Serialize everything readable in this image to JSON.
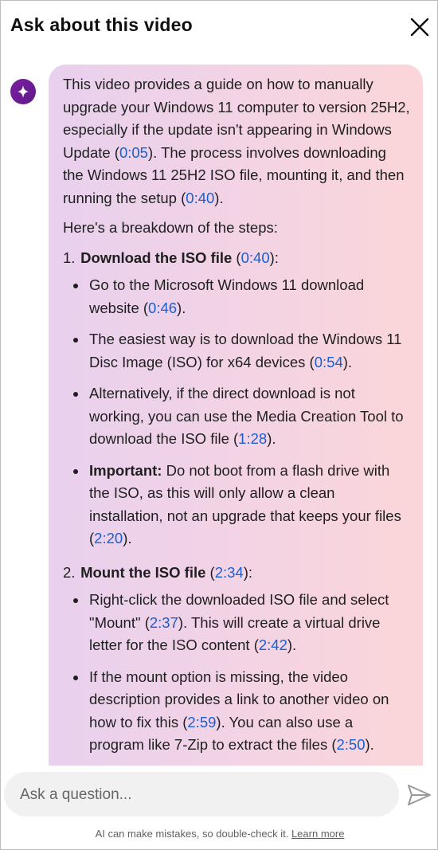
{
  "header": {
    "title": "Ask about this video"
  },
  "message": {
    "intro": {
      "t1": "This video provides a guide on how to manually upgrade your Windows 11 computer to version 25H2, especially if the update isn't appearing in Windows Update (",
      "ts1": "0:05",
      "t2": "). The process involves downloading the Windows 11 25H2 ISO file, mounting it, and then running the setup (",
      "ts2": "0:40",
      "t3": ")."
    },
    "breakdown": "Here's a breakdown of the steps:",
    "steps": [
      {
        "num": "1.",
        "title": "Download the ISO file",
        "ts": "0:40",
        "bullets": [
          {
            "text": "Go to the Microsoft Windows 11 download website (",
            "ts": "0:46",
            "end": ")."
          },
          {
            "text": "The easiest way is to download the Windows 11 Disc Image (ISO) for x64 devices (",
            "ts": "0:54",
            "end": ")."
          },
          {
            "text": "Alternatively, if the direct download is not working, you can use the Media Creation Tool to download the ISO file (",
            "ts": "1:28",
            "end": ")."
          },
          {
            "bold": "Important:",
            "text": " Do not boot from a flash drive with the ISO, as this will only allow a clean installation, not an upgrade that keeps your files (",
            "ts": "2:20",
            "end": ")."
          }
        ]
      },
      {
        "num": "2.",
        "title": "Mount the ISO file",
        "ts": "2:34",
        "bullets": [
          {
            "text": "Right-click the downloaded ISO file and select \"Mount\" (",
            "ts": "2:37",
            "mid": "). This will create a virtual drive letter for the ISO content (",
            "ts2": "2:42",
            "end": ")."
          },
          {
            "text": "If the mount option is missing, the video description provides a link to another video on how to fix this (",
            "ts": "2:59",
            "mid": "). You can also use a program like 7-Zip to extract the files (",
            "ts2": "2:50",
            "end": ")."
          }
        ]
      }
    ]
  },
  "input": {
    "placeholder": "Ask a question..."
  },
  "footer": {
    "text": "AI can make mistakes, so double-check it. ",
    "link": "Learn more"
  }
}
